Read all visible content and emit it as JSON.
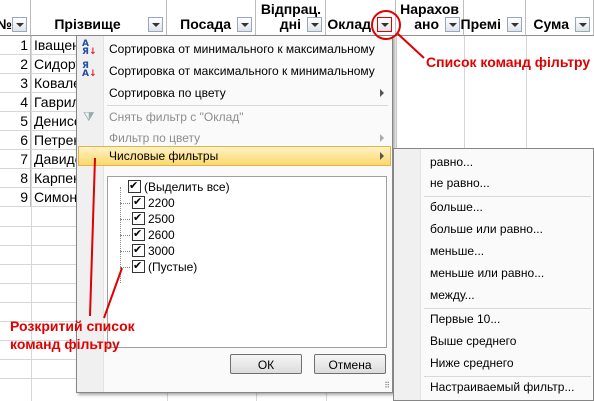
{
  "headers": {
    "num": "№",
    "surname": "Прізвище",
    "position": "Посада",
    "days_line1": "Відпрац.",
    "days_line2": "дні",
    "salary": "Оклад",
    "accrued_line1": "Нарахов",
    "accrued_line2": "ано",
    "bonus": "Премі",
    "sum": "Сума"
  },
  "rows": [
    {
      "num": "1",
      "name": "Іващен"
    },
    {
      "num": "2",
      "name": "Сидору"
    },
    {
      "num": "3",
      "name": "Ковале"
    },
    {
      "num": "4",
      "name": "Гаврил"
    },
    {
      "num": "5",
      "name": "Денисе"
    },
    {
      "num": "6",
      "name": "Петрен"
    },
    {
      "num": "7",
      "name": "Давидо"
    },
    {
      "num": "8",
      "name": "Карпен"
    },
    {
      "num": "9",
      "name": "Симоне"
    }
  ],
  "menu": {
    "sort_asc": "Сортировка от минимального к максимальному",
    "sort_desc": "Сортировка от максимального к минимальному",
    "sort_color": "Сортировка по цвету",
    "clear_filter": "Снять фильтр с \"Оклад\"",
    "filter_color": "Фильтр по цвету",
    "number_filters": "Числовые фильтры",
    "checklist": [
      "(Выделить все)",
      "2200",
      "2500",
      "2600",
      "3000",
      "(Пустые)"
    ],
    "ok": "ОК",
    "cancel": "Отмена"
  },
  "submenu": [
    "равно...",
    "не равно...",
    "больше...",
    "больше или равно...",
    "меньше...",
    "меньше или равно...",
    "между...",
    "Первые 10...",
    "Выше среднего",
    "Ниже среднего",
    "Настраиваемый фильтр..."
  ],
  "annotations": {
    "filter_list": "Список команд фільтру",
    "expanded_line1": "Розкритий список",
    "expanded_line2": "команд фільтру"
  },
  "colors": {
    "annotation": "#e00000",
    "highlight": "#fad86b"
  }
}
